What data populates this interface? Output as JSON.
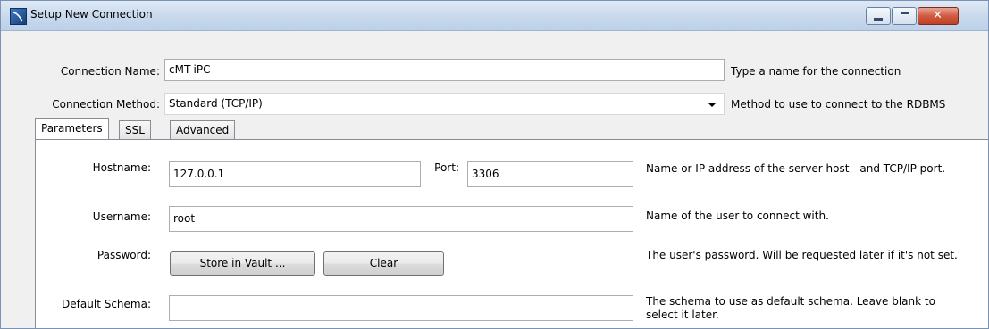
{
  "window": {
    "title": "Setup New Connection",
    "close_glyph": "✕"
  },
  "connection_name": {
    "label": "Connection Name:",
    "value": "cMT-iPC",
    "help": "Type a name for the connection"
  },
  "connection_method": {
    "label": "Connection Method:",
    "value": "Standard (TCP/IP)",
    "help": "Method to use to connect to the RDBMS"
  },
  "tabs": [
    {
      "label": "Parameters",
      "active": true
    },
    {
      "label": "SSL",
      "active": false
    },
    {
      "label": "Advanced",
      "active": false
    }
  ],
  "parameters": {
    "hostname": {
      "label": "Hostname:",
      "value": "127.0.0.1"
    },
    "port": {
      "label": "Port:",
      "value": "3306"
    },
    "hostname_help": "Name or IP address of the server host - and TCP/IP port.",
    "username": {
      "label": "Username:",
      "value": "root",
      "help": "Name of the user to connect with."
    },
    "password": {
      "label": "Password:",
      "store_button": "Store in Vault ...",
      "clear_button": "Clear",
      "help": "The user's password. Will be requested later if it's not set."
    },
    "default_schema": {
      "label": "Default Schema:",
      "value": "",
      "help": "The schema to use as default schema. Leave blank to select it later."
    }
  },
  "icons": {
    "app": "mysql-workbench-icon",
    "minimize": "minimize-icon",
    "maximize": "maximize-icon",
    "close": "close-icon",
    "dropdown": "chevron-down-icon"
  }
}
